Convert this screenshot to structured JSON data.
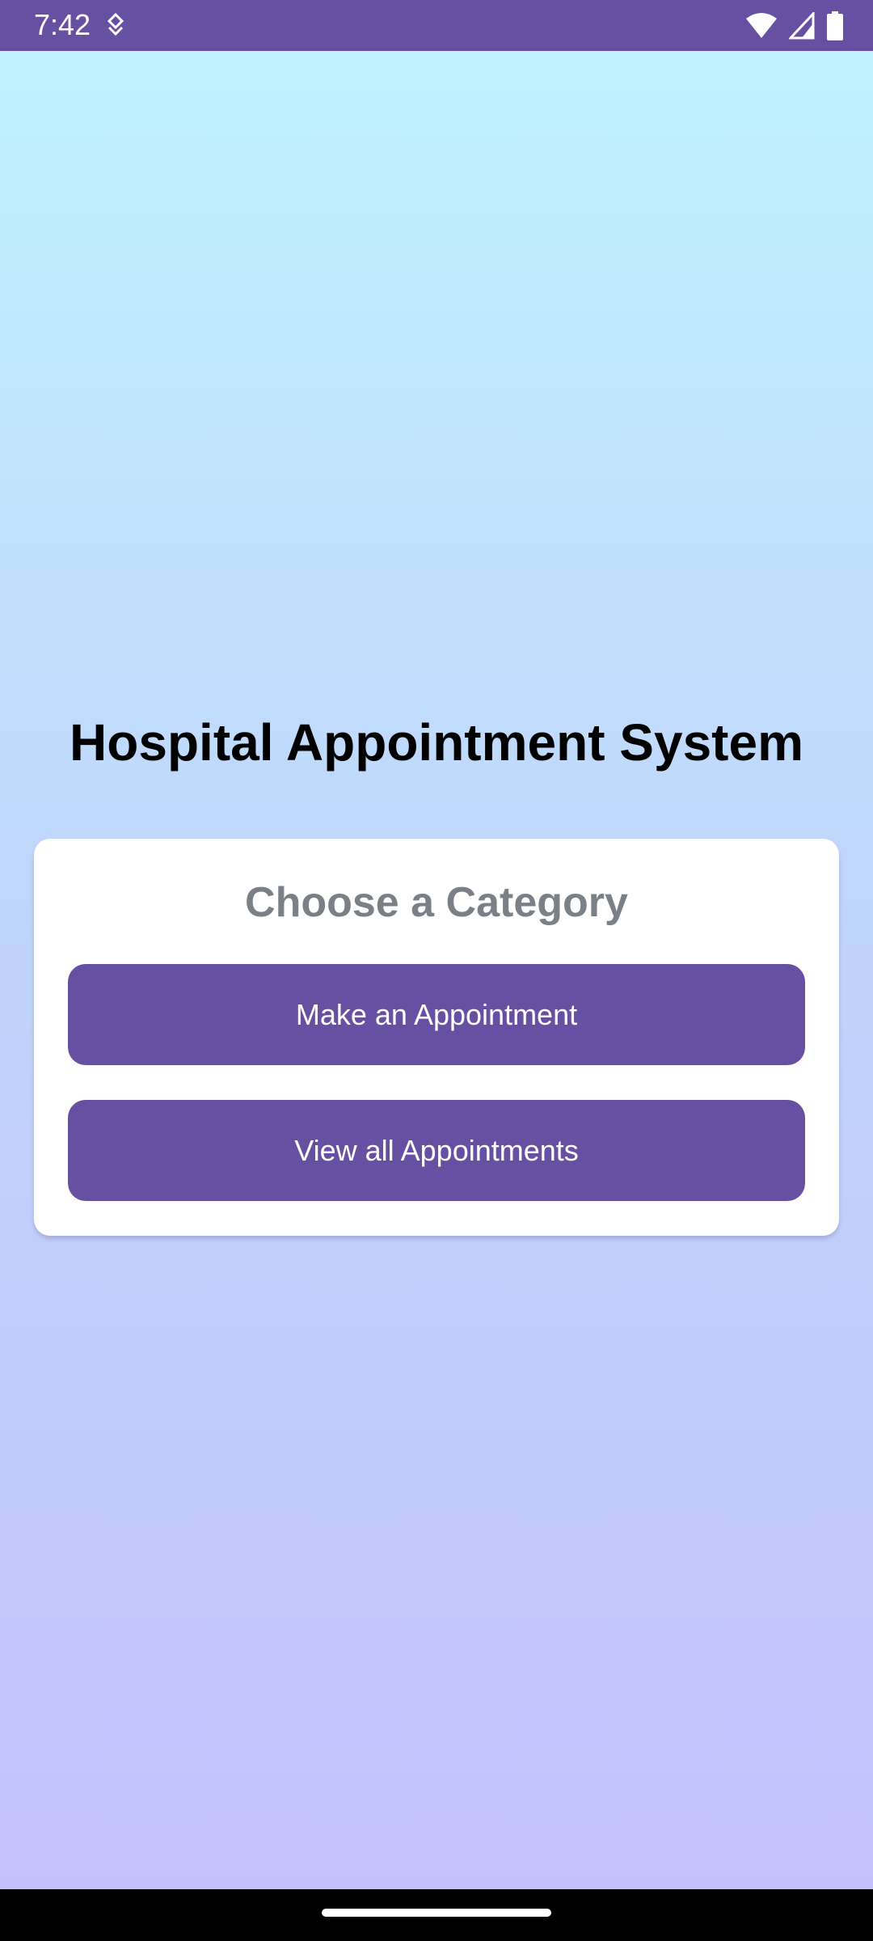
{
  "status_bar": {
    "time": "7:42",
    "icons": [
      "notification-icon",
      "wifi-icon",
      "signal-icon",
      "battery-icon"
    ],
    "background": "#674fa2"
  },
  "main": {
    "title": "Hospital Appointment System"
  },
  "card": {
    "title": "Choose a Category",
    "buttons": [
      {
        "label": "Make an Appointment"
      },
      {
        "label": "View all Appointments"
      }
    ]
  },
  "colors": {
    "accent": "#674fa2",
    "gradient_top": "#bff4fe",
    "gradient_bottom": "#c3c0fd",
    "card_title": "#7a8088"
  }
}
